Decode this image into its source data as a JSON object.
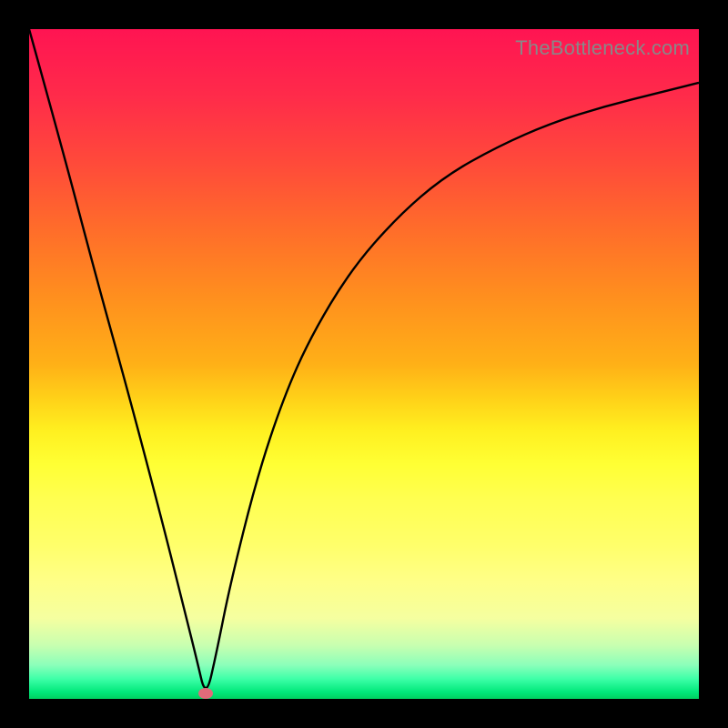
{
  "watermark": "TheBottleneck.com",
  "chart_data": {
    "type": "line",
    "title": "",
    "xlabel": "",
    "ylabel": "",
    "xlim": [
      0,
      100
    ],
    "ylim": [
      0,
      100
    ],
    "series": [
      {
        "name": "bottleneck-curve",
        "x": [
          0,
          5,
          10,
          15,
          20,
          23,
          25,
          26.4,
          28,
          30,
          34,
          38,
          42,
          48,
          55,
          62,
          70,
          78,
          86,
          94,
          100
        ],
        "y": [
          100,
          82,
          63,
          45,
          26,
          14,
          6,
          0,
          7,
          17,
          33,
          45,
          54,
          64,
          72,
          78,
          82.5,
          86,
          88.5,
          90.5,
          92
        ]
      }
    ],
    "marker": {
      "x": 26.4,
      "y": 0,
      "color": "#e16b7a"
    },
    "background_gradient": {
      "type": "vertical",
      "stops": [
        {
          "pos": 0.0,
          "color": "#ff1452"
        },
        {
          "pos": 0.5,
          "color": "#ffb017"
        },
        {
          "pos": 0.77,
          "color": "#ffff6a"
        },
        {
          "pos": 1.0,
          "color": "#00d060"
        }
      ]
    }
  }
}
